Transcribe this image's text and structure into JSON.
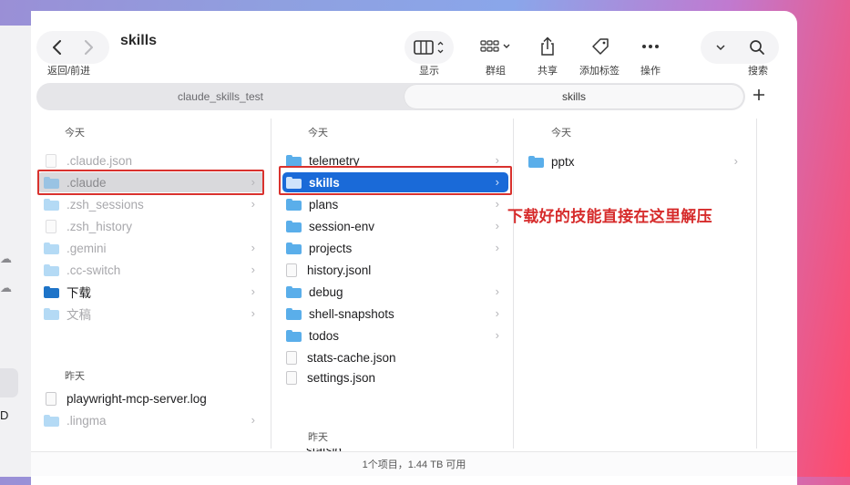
{
  "window": {
    "title": "skills",
    "nav_label": "返回/前进"
  },
  "toolbar": {
    "view_label": "显示",
    "group_label": "群组",
    "share_label": "共享",
    "tag_label": "添加标签",
    "action_label": "操作",
    "search_label": "搜索"
  },
  "tabs": [
    {
      "label": "claude_skills_test"
    },
    {
      "label": "skills"
    }
  ],
  "columns": {
    "col1": {
      "today_header": "今天",
      "items": [
        {
          "name": ".claude.json"
        },
        {
          "name": ".claude"
        },
        {
          "name": ".zsh_sessions"
        },
        {
          "name": ".zsh_history"
        },
        {
          "name": ".gemini"
        },
        {
          "name": ".cc-switch"
        },
        {
          "name": "下载"
        },
        {
          "name": "文稿"
        }
      ],
      "yesterday_header": "昨天",
      "yesterday_items": [
        {
          "name": "playwright-mcp-server.log"
        },
        {
          "name": ".lingma"
        }
      ]
    },
    "col2": {
      "today_header": "今天",
      "items": [
        {
          "name": "telemetry"
        },
        {
          "name": "skills"
        },
        {
          "name": "plans"
        },
        {
          "name": "session-env"
        },
        {
          "name": "projects"
        },
        {
          "name": "history.jsonl"
        },
        {
          "name": "debug"
        },
        {
          "name": "shell-snapshots"
        },
        {
          "name": "todos"
        },
        {
          "name": "stats-cache.json"
        },
        {
          "name": "settings.json"
        }
      ],
      "yesterday_header": "昨天",
      "yesterday_items": [
        {
          "name": "statsig"
        }
      ]
    },
    "col3": {
      "today_header": "今天",
      "items": [
        {
          "name": "pptx"
        }
      ]
    }
  },
  "annotation": "下载好的技能直接在这里解压",
  "status_bar": "1个项目，1.44 TB 可用",
  "sidebar_fragment": "D",
  "colors": {
    "selection_blue": "#1a6ad8",
    "annotation_red": "#d62b2b",
    "folder_blue": "#4aa3e8"
  }
}
